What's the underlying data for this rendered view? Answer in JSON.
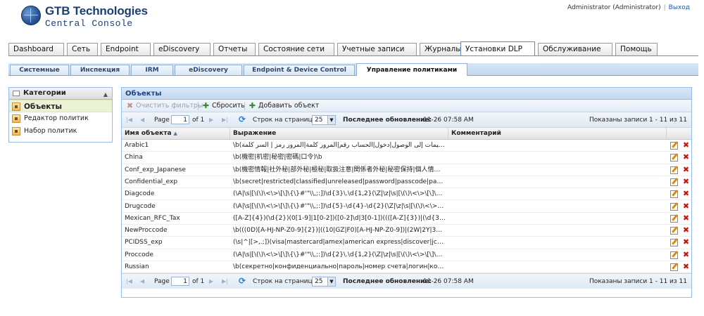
{
  "header": {
    "logo_line1": "GTB Technologies",
    "logo_line2": "Central Console",
    "user": "Administrator (Administrator)",
    "separator": "|",
    "logout": "Выход"
  },
  "main_tabs": [
    {
      "label": "Dashboard"
    },
    {
      "label": "Сеть"
    },
    {
      "label": "Endpoint"
    },
    {
      "label": "eDiscovery"
    },
    {
      "label": "Отчеты"
    },
    {
      "label": "Состояние сети"
    },
    {
      "label": "Учетные записи"
    },
    {
      "label": "Журналы"
    },
    {
      "label": "Установки DLP",
      "active": true
    },
    {
      "label": "Обслуживание"
    },
    {
      "label": "Помощь"
    }
  ],
  "sub_tabs": [
    {
      "label": "Системные"
    },
    {
      "label": "Инспекция"
    },
    {
      "label": "IRM"
    },
    {
      "label": "eDiscovery"
    },
    {
      "label": "Endpoint & Device Control"
    },
    {
      "label": "Управление политиками",
      "active": true
    }
  ],
  "categories": {
    "title": "Категории",
    "items": [
      {
        "label": "Объекты",
        "selected": true
      },
      {
        "label": "Редактор политик"
      },
      {
        "label": "Набор политик"
      }
    ]
  },
  "objects": {
    "title": "Объекты",
    "toolbar": {
      "clear_filters": "Очистить фильтры",
      "reset": "Сбросить",
      "add_object": "Добавить объект"
    },
    "pager": {
      "page_label": "Page",
      "page_value": "1",
      "of_label": "of 1",
      "rows_per_page_label": "Строк на странице:",
      "rows_per_page_value": "25",
      "last_update_label": "Последнее обновление:",
      "last_update_value": "11-26 07:58 AM",
      "records": "Показаны записи 1 - 11 из 11"
    },
    "columns": {
      "name": "Имя объекта",
      "expression": "Выражение",
      "comment": "Комментарий"
    },
    "rows": [
      {
        "name": "Arabic1",
        "expression": "\\b(السري الرقم|البرمجية التعليمات إلى الوصول|دخول|الحساب رقم|المرور كلمة|المرور رمز | السر كلمة ..."
      },
      {
        "name": "China",
        "expression": "\\b(機密|机密|秘密|密碼|口令)\\b"
      },
      {
        "name": "Conf_exp_Japanese",
        "expression": "\\b(機密情報|社外秘|部外秘|極秘|取扱注意|関係者外秘|秘密保持|個人情報|社内限定|..."
      },
      {
        "name": "Confidential_exp",
        "expression": "\\b(secret|restricted|classified|unreleased|password|passcode|passphrase|a..."
      },
      {
        "name": "Diagcode",
        "expression": "(\\A|\\s|[\\(\\)\\<\\>\\[\\]\\{\\}#'\"\\\\,;:])\\d{3}\\.\\d{1,2}(\\Z|\\z|\\s|[\\(\\)\\<\\>\\[\\]\\{\\}#'\"\\\\,;:])"
      },
      {
        "name": "Drugcode",
        "expression": "(\\A|\\s|[\\(\\)\\<\\>\\[\\]\\{\\}#'\"\\\\,;:])\\d{5}-\\d{4}-\\d{2}(\\Z|\\z|\\s|[\\(\\)\\<\\>\\[\\]\\{\\}#'\"\\\\,;:])"
      },
      {
        "name": "Mexican_RFC_Tax",
        "expression": "([A-Z]{4})(\\d{2})(0[1-9]|1[0-2])([0-2]\\d|3[0-1])((([A-Z]{3})|(\\d{3})|([A-Z]{2}\\d)|(\\..."
      },
      {
        "name": "NewProccode",
        "expression": "\\b(((0D)[A-HJ-NP-Z0-9]{2})|((10|GZ|F0)[A-HJ-NP-Z0-9])|(2W|2Y|302|3C1|3E0|..."
      },
      {
        "name": "PCIDSS_exp",
        "expression": "(\\s|^|[>,.;])(visa|mastercard|amex|american express|discover|jcb|dinersclub|di..."
      },
      {
        "name": "Proccode",
        "expression": "(\\A|\\s|[\\(\\)\\<\\>\\[\\]\\{\\}#'\"\\\\,;:])\\d{2}\\.\\d{1,2}(\\Z|\\z|\\s|[\\(\\)\\<\\>\\[\\]\\{\\}#'\"\\\\,;:])"
      },
      {
        "name": "Russian",
        "expression": "\\b(секретно|конфиденциально|пароль|номер счета|логин|код доступа|пи..."
      }
    ]
  },
  "colors": {
    "panel_border": "#99bbe8",
    "panel_header_text": "#15428b",
    "delete_icon": "#cc1111",
    "selected_category_bg": "#ecf2d6"
  }
}
